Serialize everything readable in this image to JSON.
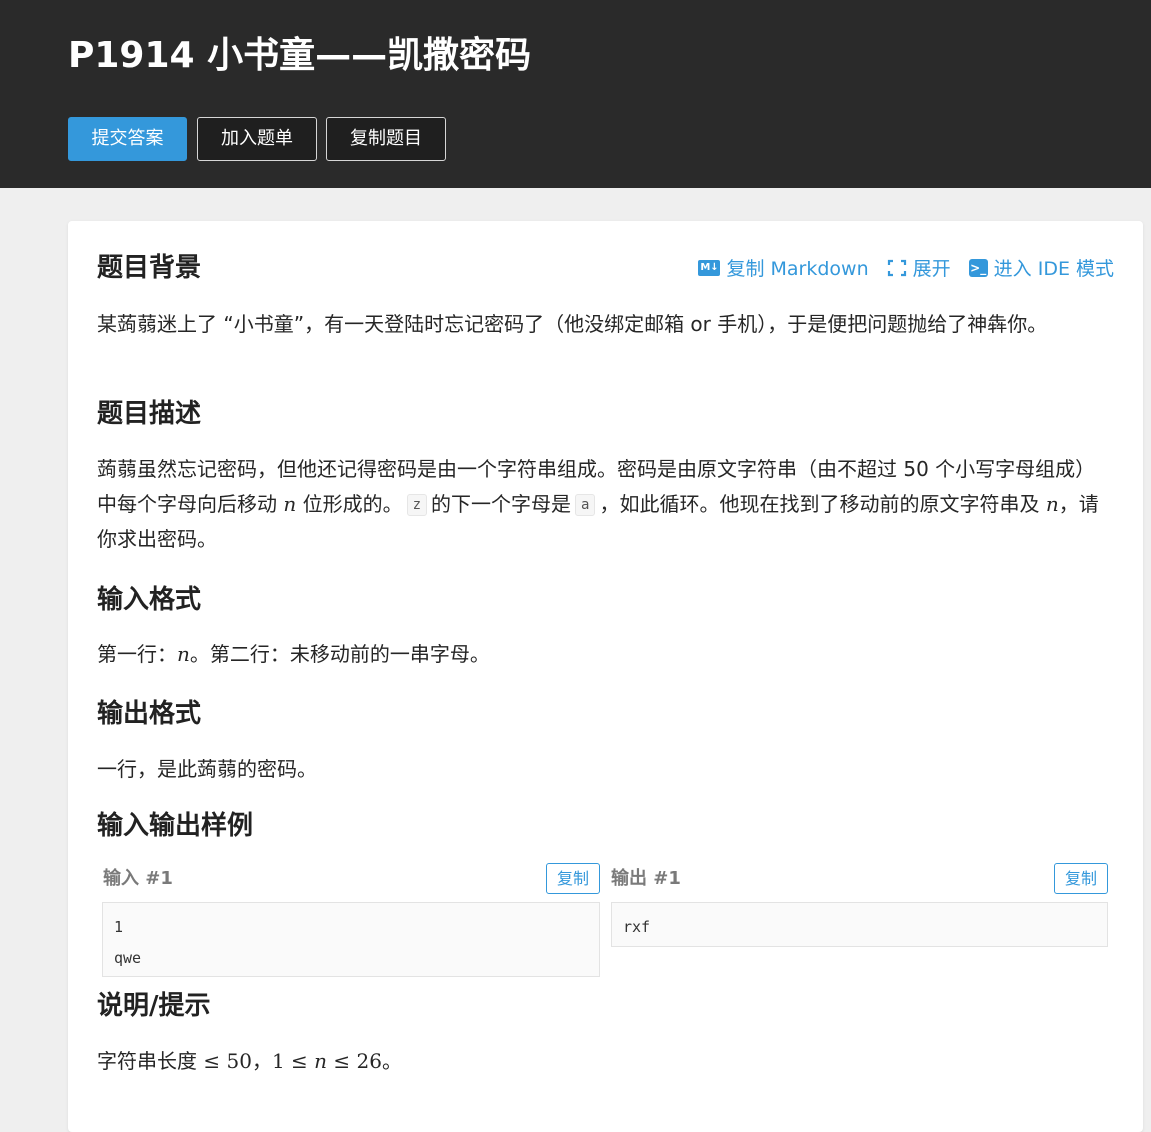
{
  "header": {
    "title": "P1914 小书童——凯撒密码",
    "buttons": {
      "submit": "提交答案",
      "add_to_list": "加入题单",
      "copy_problem": "复制题目"
    }
  },
  "tools": {
    "copy_markdown": "复制 Markdown",
    "expand": "展开",
    "ide_mode": "进入 IDE 模式"
  },
  "sections": {
    "background": {
      "title": "题目背景",
      "text": "某蒟蒻迷上了 “小书童”，有一天登陆时忘记密码了（他没绑定邮箱 or 手机），于是便把问题抛给了神犇你。"
    },
    "description": {
      "title": "题目描述",
      "part1": "蒟蒻虽然忘记密码，但他还记得密码是由一个字符串组成。密码是由原文字符串（由不超过 50 个小写字母组成）中每个字母向后移动 ",
      "var_n": "n",
      "part2": " 位形成的。",
      "code_z": "z",
      "part3": "的下一个字母是",
      "code_a": "a",
      "part4": "，如此循环。他现在找到了移动前的原文字符串及 ",
      "part5": "，请你求出密码。"
    },
    "input_format": {
      "title": "输入格式",
      "part1": "第一行：",
      "var_n": "n",
      "part2": "。第二行：未移动前的一串字母。"
    },
    "output_format": {
      "title": "输出格式",
      "text": "一行，是此蒟蒻的密码。"
    },
    "samples": {
      "title": "输入输出样例",
      "input_label": "输入 #1",
      "output_label": "输出 #1",
      "copy_label": "复制",
      "input_lines": [
        "1",
        "qwe"
      ],
      "output_lines": [
        "rxf"
      ]
    },
    "hint": {
      "title": "说明/提示",
      "part1": "字符串长度",
      "leq": "≤",
      "num50": "50",
      "comma": "，",
      "num1": "1",
      "var_n": "n",
      "num26": "26",
      "end": "。"
    }
  },
  "colors": {
    "header_bg": "#2a2a2a",
    "accent": "#3498db",
    "page_bg": "#efefef"
  }
}
